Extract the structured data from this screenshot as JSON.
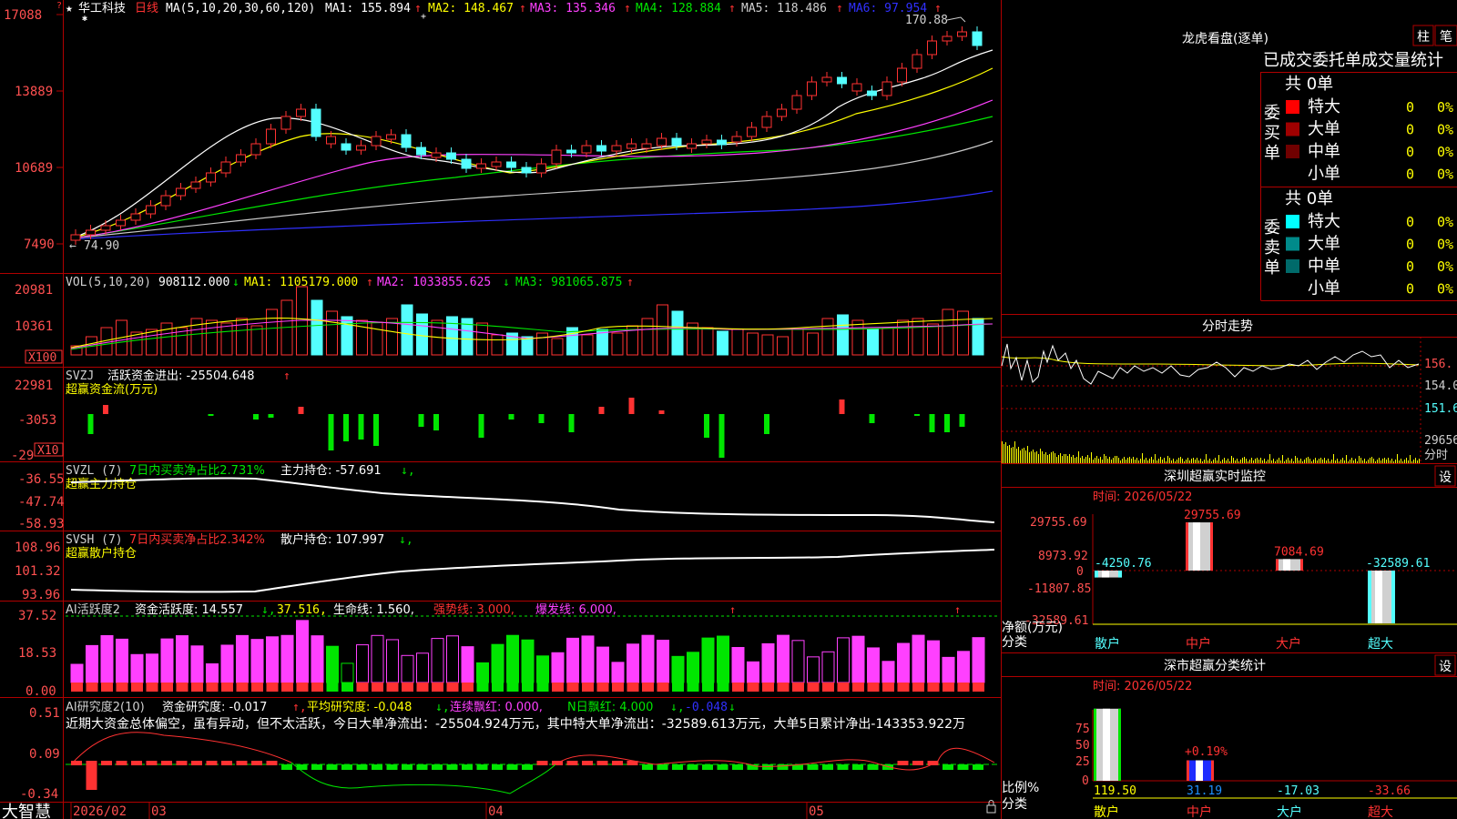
{
  "colors": {
    "up": "#ff3232",
    "down": "#54ffff",
    "grid": "#b00000",
    "label": "#ff5050",
    "ma1": "#ffffff",
    "ma2": "#ffff00",
    "ma3": "#ff00ff",
    "ma4": "#00e600",
    "ma5": "#c8c8c8",
    "ma6": "#3030ff"
  },
  "price_panel": {
    "stock_name": "华工科技",
    "period": "日线",
    "ma_def": "MA(5,10,20,30,60,120)",
    "ma1": "MA1: 155.894",
    "ma2": "MA2: 148.467",
    "ma3": "MA3: 135.346",
    "ma4": "MA4: 128.884",
    "ma5": "MA5: 118.486",
    "ma6": "MA6: 97.954",
    "axis": [
      "17088",
      "13889",
      "10689",
      "7490"
    ],
    "high_label": "170.88",
    "low_label": "74.90"
  },
  "vol_panel": {
    "title": "VOL(5,10,20)",
    "vol": "908112.000",
    "ma1": "MA1: 1105179.000",
    "ma2": "MA2: 1033855.625",
    "ma3": "MA3: 981065.875",
    "axis": [
      "20981",
      "10361"
    ],
    "unit": "X100"
  },
  "svzj_panel": {
    "title": "SVZJ",
    "text": "活跃资金进出: -25504.648",
    "subtitle": "超赢资金流(万元)",
    "axis": [
      "22981",
      "-3053",
      "-29"
    ],
    "unit": "X10"
  },
  "svzl_panel": {
    "title": "SVZL (7)",
    "ratio": "7日内买卖净占比2.731%",
    "hold": "主力持仓: -57.691",
    "subtitle": "超赢主力持仓",
    "axis": [
      "-36.55",
      "-47.74",
      "-58.93"
    ]
  },
  "svsh_panel": {
    "title": "SVSH (7)",
    "ratio": "7日内买卖净占比2.342%",
    "hold": "散户持仓: 107.997",
    "subtitle": "超赢散户持仓",
    "axis": [
      "108.96",
      "101.32",
      "93.96"
    ]
  },
  "ai2_panel": {
    "title": "AI活跃度2",
    "a": "资金活跃度: 14.557",
    "b": "37.516,",
    "c": "生命线: 1.560,",
    "d": "强势线: 3.000,",
    "e": "爆发线: 6.000,",
    "axis": [
      "37.52",
      "18.53",
      "0.00"
    ]
  },
  "ai3_panel": {
    "title": "AI研究度2(10)",
    "a": "资金研究度: -0.017",
    "b": "平均研究度: -0.048",
    "c": "连续飘红: 0.000,",
    "d": "N日飘红: 4.000",
    "e": "-0.048",
    "axis": [
      "0.51",
      "0.09",
      "-0.34"
    ],
    "comment": "近期大资金总体偏空，虽有异动，但不太活跃，今日大单净流出：-25504.924万元，其中特大单净流出：-32589.613万元，大单5日累计净出-143353.922万"
  },
  "bottom": {
    "brand": "大智慧",
    "dates": [
      "2026/02",
      "03",
      "04",
      "05"
    ]
  },
  "dragon": {
    "title": "龙虎看盘(逐单)",
    "btn1": "柱",
    "btn2": "笔",
    "tabs": "已成交委托单成交量统计",
    "buy_label": "委买单",
    "sell_label": "委卖单",
    "buy_total": "共 0单",
    "sell_total": "共 0单",
    "buy_rows": [
      {
        "name": "特大",
        "val": "0",
        "pct": "0%",
        "color": "#ff0000"
      },
      {
        "name": "大单",
        "val": "0",
        "pct": "0%",
        "color": "#a00000"
      },
      {
        "name": "中单",
        "val": "0",
        "pct": "0%",
        "color": "#700000"
      },
      {
        "name": "小单",
        "val": "0",
        "pct": "0%",
        "color": ""
      }
    ],
    "sell_rows": [
      {
        "name": "特大",
        "val": "0",
        "pct": "0%",
        "color": "#00ffff"
      },
      {
        "name": "大单",
        "val": "0",
        "pct": "0%",
        "color": "#008a8a"
      },
      {
        "name": "中单",
        "val": "0",
        "pct": "0%",
        "color": "#006a6a"
      },
      {
        "name": "小单",
        "val": "0",
        "pct": "0%",
        "color": ""
      }
    ]
  },
  "intraday": {
    "title": "分时走势",
    "axis": [
      "156.",
      "154.0",
      "151.6",
      "29656",
      "分时"
    ]
  },
  "monitor": {
    "title": "深圳超赢实时监控",
    "btn": "设",
    "time": "时间: 2026/05/22",
    "axis": [
      "29755.69",
      "8973.92",
      "0",
      "-11807.85",
      "-32589.61"
    ],
    "ylabel": "净额(万元)",
    "xlabel": "分类",
    "cats": [
      {
        "name": "散户",
        "val": "-4250.76",
        "v": -4250.76
      },
      {
        "name": "中户",
        "val": "29755.69",
        "v": 29755.69
      },
      {
        "name": "大户",
        "val": "7084.69",
        "v": 7084.69
      },
      {
        "name": "超大",
        "val": "-32589.61",
        "v": -32589.61
      }
    ]
  },
  "stats": {
    "title": "深市超赢分类统计",
    "btn": "设",
    "time": "时间: 2026/05/22",
    "axis": [
      "75",
      "50",
      "25",
      "0"
    ],
    "ylabel": "比例%",
    "xlabel": "分类",
    "cats": [
      {
        "name": "散户",
        "val": "119.50",
        "v": 119.5
      },
      {
        "name": "中户",
        "val": "31.19",
        "v": 31.19,
        "top": "+0.19%"
      },
      {
        "name": "大户",
        "val": "-17.03",
        "v": -17.03
      },
      {
        "name": "超大",
        "val": "-33.66",
        "v": -33.66
      }
    ]
  }
}
